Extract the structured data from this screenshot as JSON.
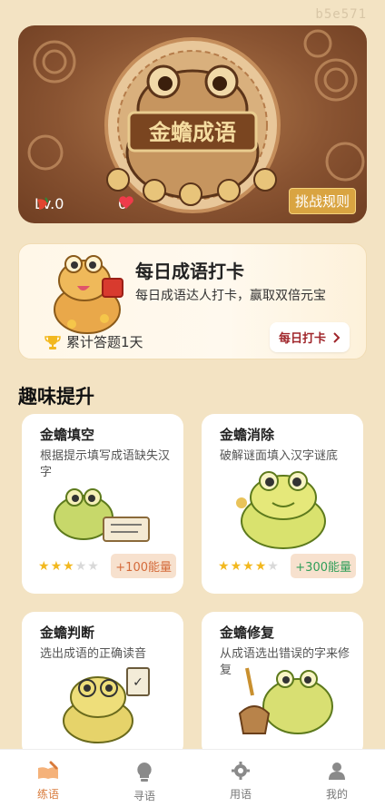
{
  "watermark": "b5e571",
  "hero": {
    "title": "金蟾成语",
    "level": "Lv.0",
    "lives": "0",
    "rules_button": "挑战规则"
  },
  "daily": {
    "title": "每日成语打卡",
    "subtitle": "每日成语达人打卡，赢取双倍元宝",
    "count": "累计答题1天",
    "button": "每日打卡",
    "button_icon": "chevron-right-icon"
  },
  "section_title": "趣味提升",
  "cards": [
    {
      "title": "金蟾填空",
      "desc": "根据提示填写成语缺失汉字",
      "stars": 3,
      "energy": "+100能量",
      "energy_color": "#d46a3a"
    },
    {
      "title": "金蟾消除",
      "desc": "破解谜面填入汉字谜底",
      "stars": 4,
      "energy": "+300能量",
      "energy_color": "#2f9e59"
    },
    {
      "title": "金蟾判断",
      "desc": "选出成语的正确读音"
    },
    {
      "title": "金蟾修复",
      "desc": "从成语选出错误的字来修复"
    }
  ],
  "nav": [
    {
      "label": "练语",
      "icon": "brush-book-icon",
      "active": true
    },
    {
      "label": "寻语",
      "icon": "lightbulb-icon",
      "active": false
    },
    {
      "label": "用语",
      "icon": "gear-icon",
      "active": false
    },
    {
      "label": "我的",
      "icon": "user-icon",
      "active": false
    }
  ],
  "colors": {
    "background": "#f3e3c3",
    "accent": "#d87a3a",
    "gold": "#d9a441",
    "red": "#a0262b"
  }
}
